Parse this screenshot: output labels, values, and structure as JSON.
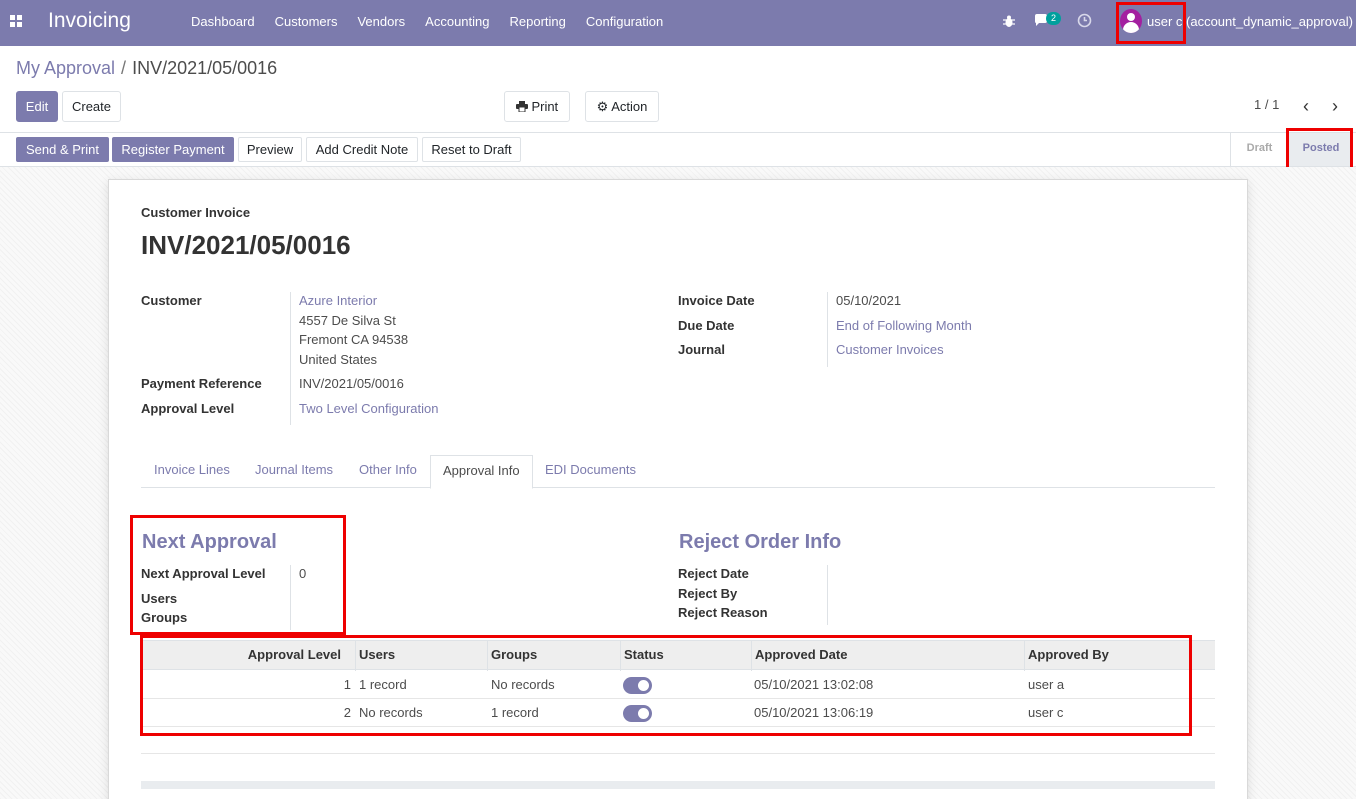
{
  "navbar": {
    "app_title": "Invoicing",
    "menu": [
      "Dashboard",
      "Customers",
      "Vendors",
      "Accounting",
      "Reporting",
      "Configuration"
    ],
    "message_count": "2",
    "user_label": "user c (account_dynamic_approval)",
    "accent_color": "#7c7bad"
  },
  "breadcrumb": {
    "parent": "My Approval",
    "separator": "/",
    "current": "INV/2021/05/0016"
  },
  "control": {
    "edit": "Edit",
    "create": "Create",
    "print": "Print",
    "action": "Action",
    "pager": "1 / 1"
  },
  "statusbar": {
    "buttons": [
      "Send & Print",
      "Register Payment",
      "Preview",
      "Add Credit Note",
      "Reset to Draft"
    ],
    "stages": [
      "Draft",
      "Posted"
    ],
    "current_stage": "Posted"
  },
  "invoice": {
    "type": "Customer Invoice",
    "number": "INV/2021/05/0016",
    "labels": {
      "customer": "Customer",
      "payment_reference": "Payment Reference",
      "approval_level": "Approval Level",
      "invoice_date": "Invoice Date",
      "due_date": "Due Date",
      "journal": "Journal"
    },
    "customer_name": "Azure Interior",
    "address": [
      "4557 De Silva St",
      "Fremont CA 94538",
      "United States"
    ],
    "payment_reference": "INV/2021/05/0016",
    "approval_level": "Two Level Configuration",
    "invoice_date": "05/10/2021",
    "due_date": "End of Following Month",
    "journal": "Customer Invoices"
  },
  "tabs": [
    "Invoice Lines",
    "Journal Items",
    "Other Info",
    "Approval Info",
    "EDI Documents"
  ],
  "active_tab": "Approval Info",
  "next_approval": {
    "title": "Next Approval",
    "level_label": "Next Approval Level",
    "level_value": "0",
    "users_label": "Users",
    "groups_label": "Groups"
  },
  "reject_info": {
    "title": "Reject Order Info",
    "date_label": "Reject Date",
    "by_label": "Reject By",
    "reason_label": "Reject Reason"
  },
  "approval_table": {
    "headers": [
      "Approval Level",
      "Users",
      "Groups",
      "Status",
      "Approved Date",
      "Approved By"
    ],
    "rows": [
      {
        "level": "1",
        "users": "1 record",
        "groups": "No records",
        "status": true,
        "date": "05/10/2021 13:02:08",
        "by": "user a"
      },
      {
        "level": "2",
        "users": "No records",
        "groups": "1 record",
        "status": true,
        "date": "05/10/2021 13:06:19",
        "by": "user c"
      }
    ]
  }
}
